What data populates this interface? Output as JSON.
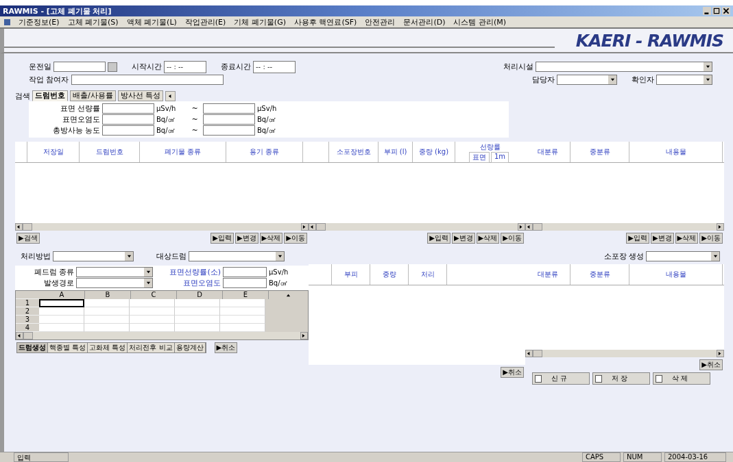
{
  "window": {
    "title": "RAWMIS - [고체 폐기물 처리]"
  },
  "menu": [
    "기준정보(E)",
    "고체 폐기물(S)",
    "액체 폐기물(L)",
    "작업관리(E)",
    "기체 폐기물(G)",
    "사용후 핵연료(SF)",
    "안전관리",
    "문서관리(D)",
    "시스템 관리(M)"
  ],
  "logo": "KAERI - RAWMIS",
  "header_left": [
    {
      "label": "운전일",
      "kind": "date"
    },
    {
      "label": "시작시간",
      "kind": "time",
      "placeholder": "-- : --"
    },
    {
      "label": "종료시간",
      "kind": "time",
      "placeholder": "-- : --"
    },
    {
      "label": "작업 참여자",
      "kind": "text"
    }
  ],
  "header_right": [
    {
      "label": "처리시설",
      "kind": "select"
    },
    {
      "label": "담당자",
      "kind": "select"
    },
    {
      "label": "확인자",
      "kind": "select"
    }
  ],
  "search_label": "검색",
  "tabs": [
    {
      "label": "드럼번호",
      "selected": true
    },
    {
      "label": "배출/사용률",
      "selected": false
    },
    {
      "label": "방사선 특성",
      "selected": false
    }
  ],
  "filters": [
    {
      "label": "표면 선량률",
      "unit_from": "μSv/h",
      "sep": "~",
      "unit_to": "μSv/h"
    },
    {
      "label": "표면오염도",
      "unit_from": "Bq/㎠",
      "sep": "~",
      "unit_to": "Bq/㎠"
    },
    {
      "label": "총방사능 농도",
      "unit_from": "Bq/㎠",
      "sep": "~",
      "unit_to": "Bq/㎠"
    }
  ],
  "drum_table": {
    "columns": [
      "저장일",
      "드럼번호",
      "폐기물 종류",
      "용기 종류"
    ],
    "buttons": [
      "▶입력",
      "▶변경",
      "▶삭제",
      "▶이동"
    ],
    "search_button": "▶검색"
  },
  "package_table": {
    "columns": [
      "소포장번호",
      "부피 (l)",
      "중량 (kg)",
      "선량률"
    ],
    "subcolumns": [
      "표면",
      "1m"
    ],
    "buttons": [
      "▶입력",
      "▶변경",
      "▶삭제",
      "▶이동"
    ]
  },
  "content_table": {
    "columns": [
      "대분류",
      "중분류",
      "내용물"
    ],
    "buttons": [
      "▶입력",
      "▶변경",
      "▶삭제",
      "▶이동"
    ]
  },
  "process_form": {
    "method_label": "처리방법",
    "target_label": "대상드럼",
    "drum_type_label": "폐드럼 종류",
    "origin_label": "발생경로",
    "dose_label": "표면선량률(소)",
    "dose_unit": "μSv/h",
    "contam_label": "표면오염도",
    "contam_unit": "Bq/㎠"
  },
  "sheet": {
    "columns": [
      "A",
      "B",
      "C",
      "D",
      "E"
    ],
    "rows": [
      "1",
      "2",
      "3",
      "4"
    ]
  },
  "sheet_tabs": [
    {
      "label": "드럼생성",
      "selected": true
    },
    {
      "label": "핵종별 특성",
      "selected": false
    },
    {
      "label": "고화체 특성",
      "selected": false
    },
    {
      "label": "처리전후 비교",
      "selected": false
    },
    {
      "label": "용량계산",
      "selected": false
    }
  ],
  "cancel_left": "▶취소",
  "result_table": {
    "columns": [
      "부피",
      "중량",
      "처리"
    ],
    "cancel": "▶취소"
  },
  "package_create": {
    "label": "소포장 생성",
    "columns": [
      "대분류",
      "중분류",
      "내용물"
    ],
    "cancel": "▶취소"
  },
  "actions": [
    "신 규",
    "저 장",
    "삭 제"
  ],
  "status_bar": [
    "입력",
    "CAPS",
    "NUM",
    "2004-03-16"
  ]
}
